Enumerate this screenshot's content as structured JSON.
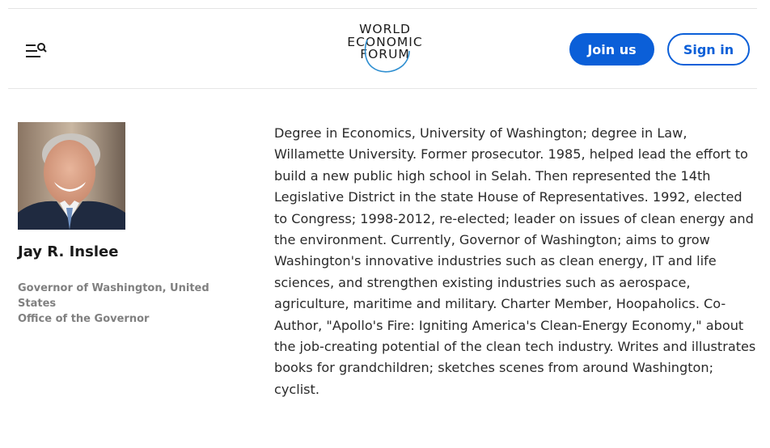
{
  "header": {
    "menu_icon": "menu-search-icon",
    "logo": {
      "line1": "WORLD",
      "line2": "ECONOMIC",
      "line3": "FORUM"
    },
    "join_label": "Join us",
    "signin_label": "Sign in",
    "accent_color": "#0b5fd8"
  },
  "profile": {
    "photo_alt": "Jay R. Inslee",
    "name": "Jay R. Inslee",
    "title": "Governor of Washington, United States",
    "organization": "Office of the Governor",
    "bio": "Degree in Economics, University of Washington; degree in Law, Willamette University. Former prosecutor. 1985, helped lead the effort to build a new public high school in Selah. Then represented the 14th Legislative District in the state House of Representatives. 1992, elected to Congress; 1998-2012, re-elected; leader on issues of clean energy and the environment. Currently, Governor of Washington; aims to grow Washington's innovative industries such as clean energy, IT and life sciences, and strengthen existing industries such as aerospace, agriculture, maritime and military. Charter Member, Hoopaholics. Co-Author, \"Apollo's Fire: Igniting America's Clean-Energy Economy,\" about the job-creating potential of the clean tech industry. Writes and illustrates books for grandchildren; sketches scenes from around Washington; cyclist."
  }
}
